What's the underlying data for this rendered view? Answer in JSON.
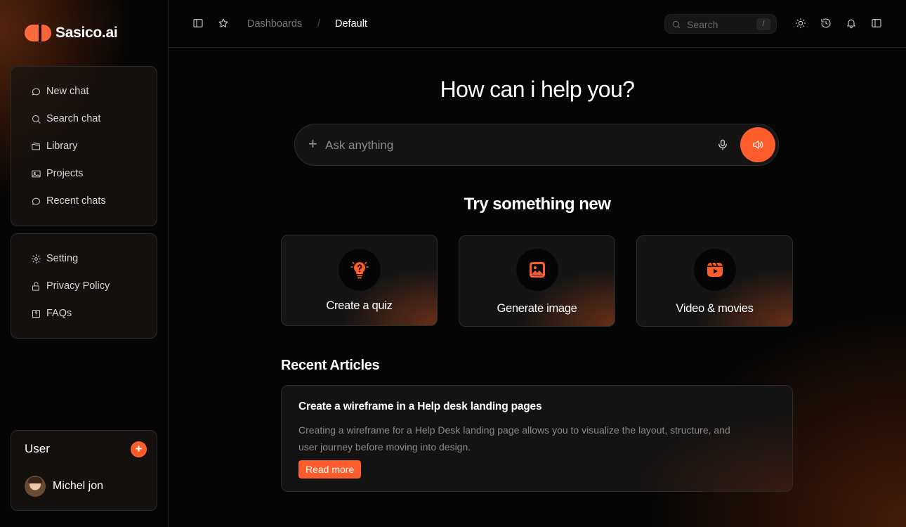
{
  "brand": {
    "name": "Sasico.ai",
    "accent": "#ff5c2b"
  },
  "sidebar": {
    "primary": [
      {
        "label": "New chat",
        "icon": "chat-bubble-icon"
      },
      {
        "label": "Search chat",
        "icon": "search-icon"
      },
      {
        "label": "Library",
        "icon": "folder-icon"
      },
      {
        "label": "Projects",
        "icon": "image-icon"
      },
      {
        "label": "Recent chats",
        "icon": "chat-bubble-icon"
      }
    ],
    "secondary": [
      {
        "label": "Setting",
        "icon": "gear-icon"
      },
      {
        "label": "Privacy Policy",
        "icon": "lock-icon"
      },
      {
        "label": "FAQs",
        "icon": "question-icon"
      }
    ],
    "user": {
      "title": "User",
      "add_label": "+",
      "name": "Michel jon"
    }
  },
  "topbar": {
    "breadcrumb": {
      "parent": "Dashboards",
      "separator": "/",
      "current": "Default"
    },
    "search": {
      "placeholder": "Search",
      "shortcut": "/"
    }
  },
  "main": {
    "hero": "How can i help you?",
    "ask": {
      "placeholder": "Ask anything",
      "plus": "+"
    },
    "subhead": "Try something new",
    "cards": [
      {
        "label": "Create a quiz",
        "icon": "lightbulb-question-icon"
      },
      {
        "label": "Generate image",
        "icon": "image-icon"
      },
      {
        "label": "Video & movies",
        "icon": "video-play-icon"
      }
    ],
    "articles_title": "Recent Articles",
    "article": {
      "title": "Create a wireframe in a Help desk landing pages",
      "description": "Creating a wireframe for a Help Desk landing page allows you to visualize the layout, structure, and user journey before moving into design.",
      "button": "Read more"
    }
  }
}
